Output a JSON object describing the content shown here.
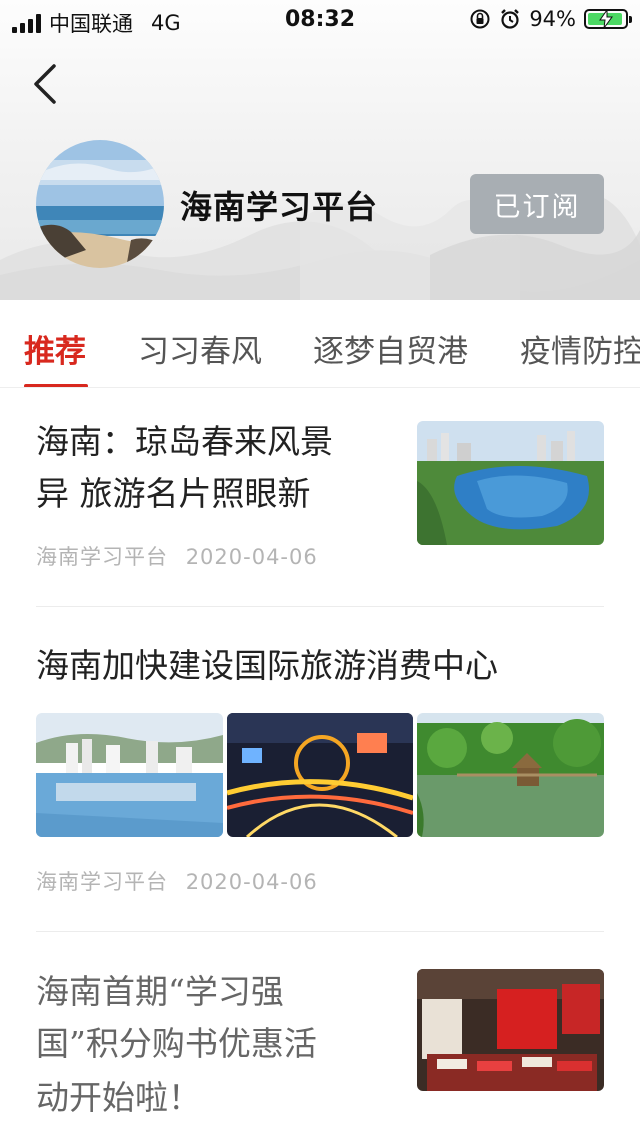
{
  "status_bar": {
    "carrier": "中国联通",
    "network": "4G",
    "time": "08:32",
    "battery": "94%"
  },
  "channel": {
    "name": "海南学习平台",
    "subscribe_label": "已订阅"
  },
  "tabs": [
    {
      "label": "推荐",
      "active": true
    },
    {
      "label": "习习春风",
      "active": false
    },
    {
      "label": "逐梦自贸港",
      "active": false
    },
    {
      "label": "疫情防控",
      "active": false
    }
  ],
  "articles": [
    {
      "title_line1": "海南：琼岛春来风景",
      "title_line2": "异 旅游名片照眼新",
      "source": "海南学习平台",
      "date": "2020-04-06"
    },
    {
      "title": "海南加快建设国际旅游消费中心",
      "source": "海南学习平台",
      "date": "2020-04-06"
    },
    {
      "title_line1": "海南首期“学习强",
      "title_line2": "国”积分购书优惠活",
      "title_line3": "动开始啦！"
    }
  ],
  "icons": [
    "back-icon",
    "signal-icon",
    "orientation-lock-icon",
    "alarm-icon",
    "battery-icon"
  ],
  "colors": {
    "accent": "#d8281e",
    "subscribed_button": "#a8aeb3",
    "battery_fill": "#4cd964"
  }
}
